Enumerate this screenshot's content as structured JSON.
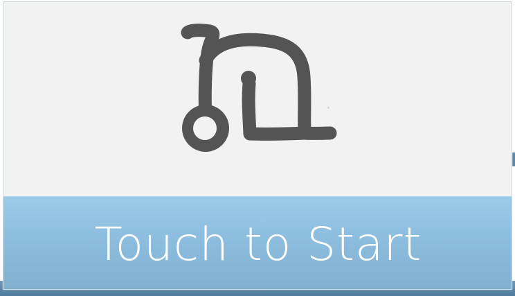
{
  "screen": {
    "background": "#ffffff"
  },
  "logo": {
    "icon": "robot-elephant-logo-icon",
    "color": "#545454"
  },
  "start_button": {
    "label": "Touch to Start",
    "background": "#8fbfe0",
    "text_color": "#ffffff"
  }
}
